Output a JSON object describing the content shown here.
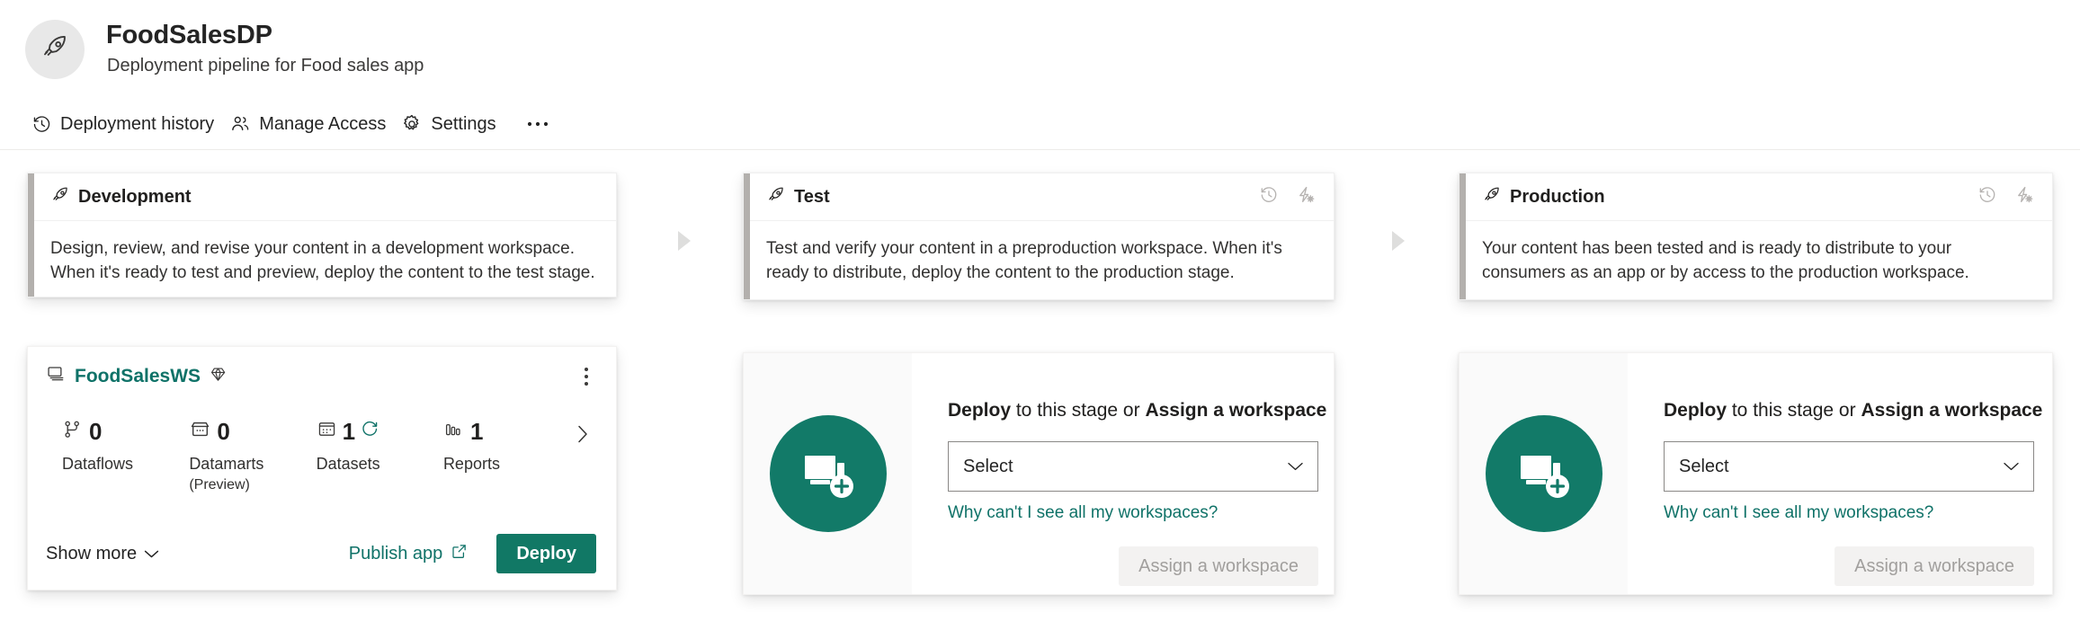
{
  "header": {
    "avatar_icon": "rocket-icon",
    "title": "FoodSalesDP",
    "subtitle": "Deployment pipeline for Food sales app"
  },
  "toolbar": {
    "items": [
      {
        "icon": "history-icon",
        "label": "Deployment history"
      },
      {
        "icon": "people-icon",
        "label": "Manage Access"
      },
      {
        "icon": "gear-icon",
        "label": "Settings"
      }
    ],
    "overflow_label": "•••"
  },
  "colors": {
    "brand_teal": "#0f7268",
    "deploy_button": "#117865",
    "illustration": "#127a68",
    "stage_accent": "#b3b0ad",
    "connector": "#dededd",
    "disabled_button_bg": "#f3f2f1",
    "disabled_button_text": "#a19f9d"
  },
  "stages": [
    {
      "id": "development",
      "icon": "rocket-icon",
      "name": "Development",
      "description": "Design, review, and revise your content in a development workspace. When it's ready to test and preview, deploy the content to the test stage.",
      "head_actions": [],
      "content_type": "workspace",
      "workspace": {
        "layers_icon": "layers-icon",
        "name": "FoodSalesWS",
        "premium_icon": "diamond-icon",
        "kebab_icon": "more-vertical-icon",
        "metrics": [
          {
            "icon": "dataflow-icon",
            "count": "0",
            "label": "Dataflows",
            "sub": "",
            "status_icon": ""
          },
          {
            "icon": "datamart-icon",
            "count": "0",
            "label": "Datamarts",
            "sub": "(Preview)",
            "status_icon": ""
          },
          {
            "icon": "dataset-icon",
            "count": "1",
            "label": "Datasets",
            "sub": "",
            "status_icon": "refresh-icon"
          },
          {
            "icon": "report-icon",
            "count": "1",
            "label": "Reports",
            "sub": "",
            "status_icon": ""
          }
        ],
        "next_icon": "chevron-right-icon",
        "show_more_label": "Show more",
        "show_more_icon": "chevron-down-icon",
        "publish_app_label": "Publish app",
        "publish_app_icon": "open-in-new-icon",
        "deploy_label": "Deploy"
      }
    },
    {
      "id": "test",
      "icon": "rocket-icon",
      "name": "Test",
      "description": "Test and verify your content in a preproduction workspace. When it's ready to distribute, deploy the content to the production stage.",
      "head_actions": [
        {
          "icon": "history-icon"
        },
        {
          "icon": "deployment-rules-icon"
        }
      ],
      "content_type": "assign",
      "assign": {
        "illustration_icon": "add-workspace-icon",
        "title_prefix": "Deploy",
        "title_middle": " to this stage or ",
        "title_suffix": "Assign a workspace",
        "select_value": "Select",
        "select_placeholder": "Select",
        "select_chevron_icon": "chevron-down-icon",
        "help_link": "Why can't I see all my workspaces?",
        "assign_button_label": "Assign a workspace"
      }
    },
    {
      "id": "production",
      "icon": "rocket-icon",
      "name": "Production",
      "description": "Your content has been tested and is ready to distribute to your consumers as an app or by access to the production workspace.",
      "head_actions": [
        {
          "icon": "history-icon"
        },
        {
          "icon": "deployment-rules-icon"
        }
      ],
      "content_type": "assign",
      "assign": {
        "illustration_icon": "add-workspace-icon",
        "title_prefix": "Deploy",
        "title_middle": " to this stage or ",
        "title_suffix": "Assign a workspace",
        "select_value": "Select",
        "select_placeholder": "Select",
        "select_chevron_icon": "chevron-down-icon",
        "help_link": "Why can't I see all my workspaces?",
        "assign_button_label": "Assign a workspace"
      }
    }
  ],
  "connectors": [
    {
      "icon": "arrow-right-icon"
    },
    {
      "icon": "arrow-right-icon"
    }
  ]
}
